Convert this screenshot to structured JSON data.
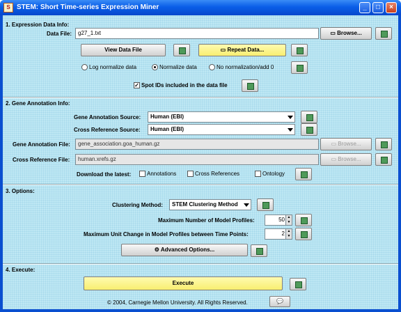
{
  "window": {
    "title": "STEM: Short Time-series Expression Miner",
    "app_icon": "stem-app-icon"
  },
  "expression": {
    "section_title": "1. Expression Data Info:",
    "data_file_label": "Data File:",
    "data_file_value": "g27_1.txt",
    "browse_label": "Browse...",
    "view_button": "View Data File",
    "repeat_button": "Repeat Data...",
    "normalization_options": [
      "Log normalize data",
      "Normalize data",
      "No normalization/add 0"
    ],
    "normalization_selected": "Normalize data",
    "spot_ids_label": "Spot IDs included in the data file",
    "spot_ids_checked": true
  },
  "gene_annotation": {
    "section_title": "2. Gene Annotation Info:",
    "source_label": "Gene Annotation Source:",
    "source_value": "Human (EBI)",
    "cross_ref_source_label": "Cross Reference Source:",
    "cross_ref_source_value": "Human (EBI)",
    "annotation_file_label": "Gene Annotation File:",
    "annotation_file_value": "gene_association.goa_human.gz",
    "cross_ref_file_label": "Cross Reference File:",
    "cross_ref_file_value": "human.xrefs.gz",
    "browse_label": "Browse...",
    "download_label": "Download the latest:",
    "download_options": [
      "Annotations",
      "Cross References",
      "Ontology"
    ]
  },
  "options": {
    "section_title": "3. Options:",
    "clustering_label": "Clustering Method:",
    "clustering_value": "STEM Clustering Method",
    "max_profiles_label": "Maximum Number of Model Profiles:",
    "max_profiles_value": "50",
    "max_unit_change_label": "Maximum Unit Change in Model Profiles between Time Points:",
    "max_unit_change_value": "2",
    "advanced_button": "Advanced Options..."
  },
  "execute": {
    "section_title": "4. Execute:",
    "execute_button": "Execute",
    "copyright": "© 2004, Carnegie Mellon University.  All Rights Reserved."
  },
  "colors": {
    "panel": "#bfe8f4",
    "titlebar": "#0a5ee8",
    "accent_button": "#fffbb0",
    "help_icon": "#4f9a5a"
  }
}
